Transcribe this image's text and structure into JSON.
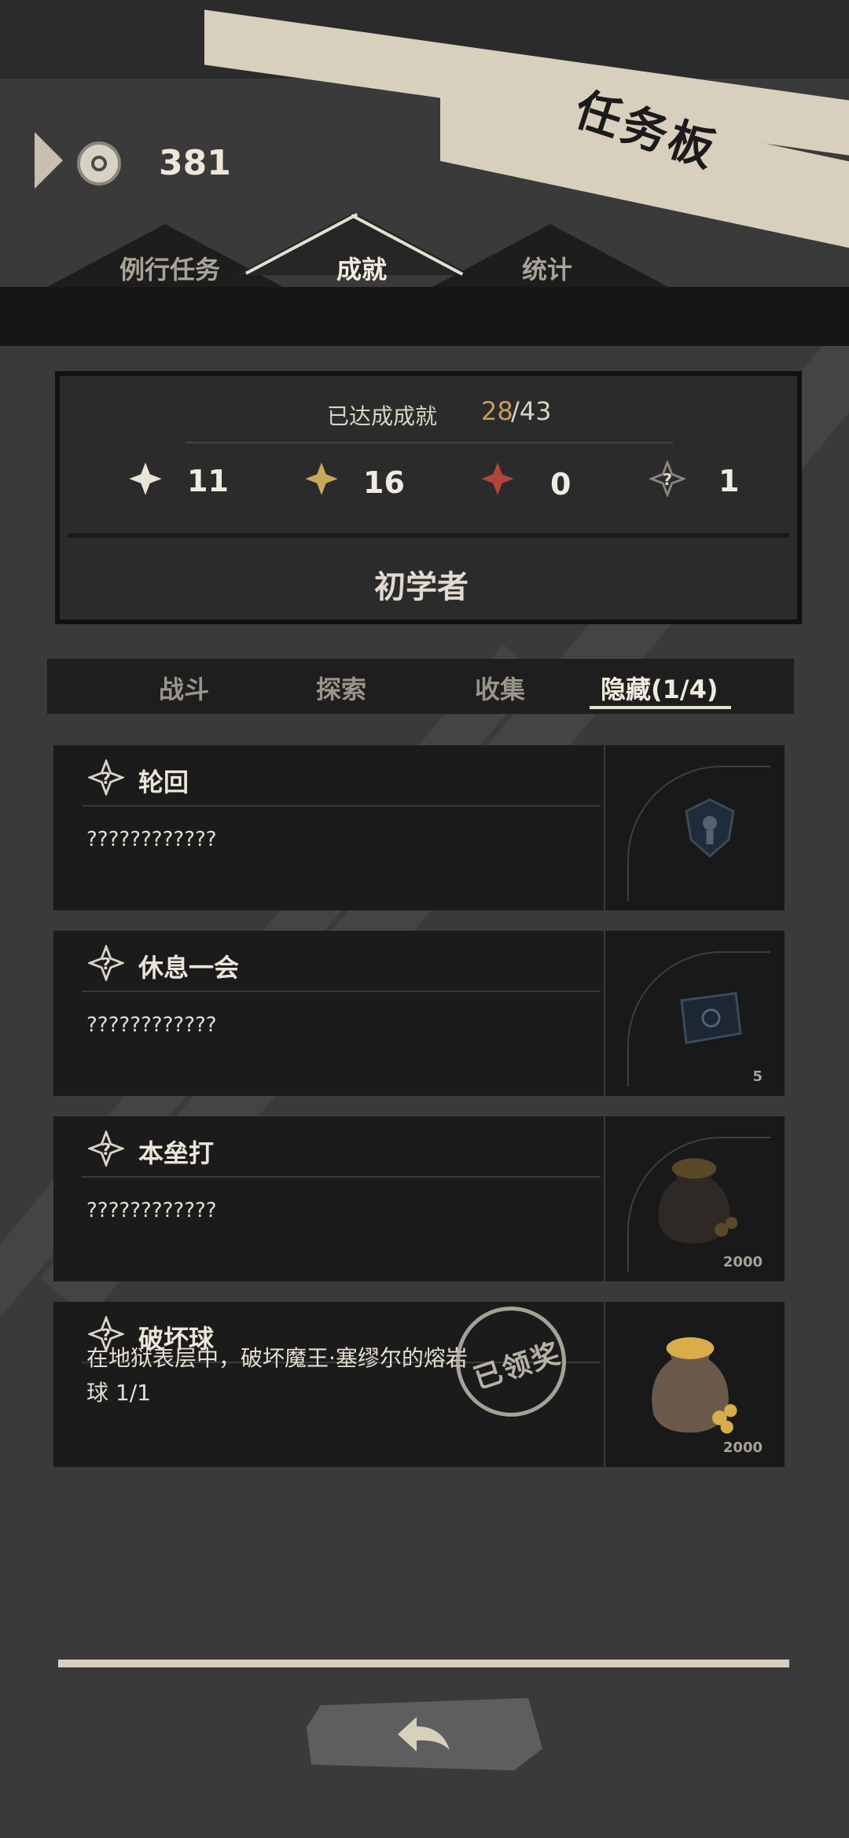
{
  "header": {
    "title": "任务板",
    "currency": {
      "icon": "coin-eye-icon",
      "value": "381"
    }
  },
  "tabs": [
    {
      "label": "例行任务",
      "active": false
    },
    {
      "label": "成就",
      "active": true
    },
    {
      "label": "统计",
      "active": false
    }
  ],
  "summary": {
    "label": "已达成成就",
    "achieved": "28",
    "total": "/43",
    "stars": [
      {
        "icon": "white-star-icon",
        "color": "#e9e3d6",
        "count": "11"
      },
      {
        "icon": "gold-star-icon",
        "color": "#c9a85a",
        "count": "16"
      },
      {
        "icon": "red-star-icon",
        "color": "#b0463a",
        "count": "0"
      },
      {
        "icon": "hidden-star-icon",
        "color": "#8a857c",
        "count": "1"
      }
    ],
    "rank": "初学者"
  },
  "categories": [
    {
      "label": "战斗",
      "active": false
    },
    {
      "label": "探索",
      "active": false
    },
    {
      "label": "收集",
      "active": false
    },
    {
      "label": "隐藏(1/4)",
      "active": true
    }
  ],
  "cards": [
    {
      "title": "轮回",
      "description": "????????????",
      "reward": "",
      "reward_icon": "emblem-icon",
      "claimed": false
    },
    {
      "title": "休息一会",
      "description": "????????????",
      "reward": "5",
      "reward_icon": "ticket-icon",
      "claimed": false
    },
    {
      "title": "本垒打",
      "description": "????????????",
      "reward": "2000",
      "reward_icon": "gold-bag-icon",
      "claimed": false
    },
    {
      "title": "破坏球",
      "description": "在地狱表层中，破坏魔王·塞缪尔的熔岩球 1/1",
      "reward": "2000",
      "reward_icon": "gold-bag-icon",
      "claimed": true,
      "stamp": "已领奖"
    }
  ],
  "back_button": {
    "icon": "back-arrow-icon"
  }
}
